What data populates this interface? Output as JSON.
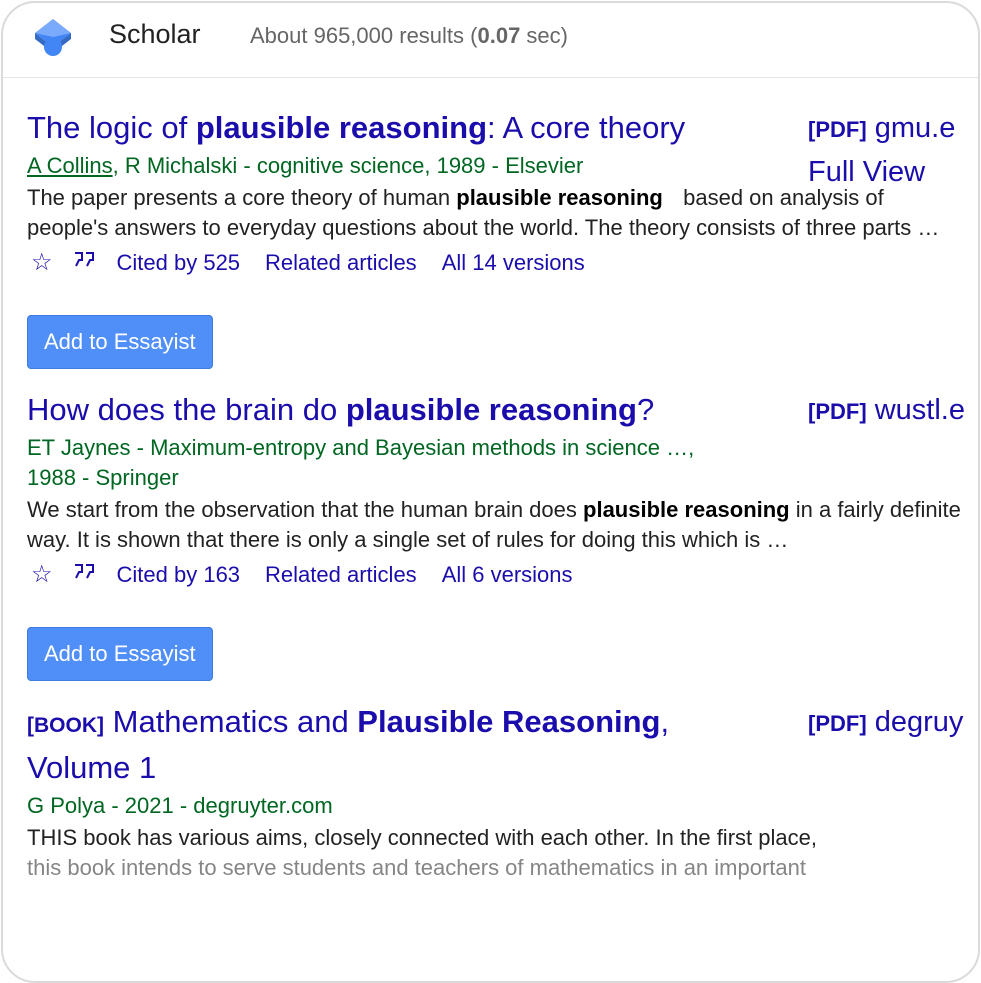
{
  "header": {
    "brand": "Scholar",
    "stats_prefix": "About 965,000 results (",
    "stats_time": "0.07",
    "stats_suffix": " sec)"
  },
  "results": [
    {
      "title_parts": [
        "The logic of ",
        "plausible reasoning",
        ": A core theory"
      ],
      "side_tag": "[PDF]",
      "side_source": "gmu.e",
      "side_link": "Full View",
      "authors_link": "A Collins",
      "meta_rest": ", R Michalski - cognitive science, 1989 - Elsevier",
      "snippet_parts": [
        "The paper presents a core theory of human ",
        "plausible reasoning",
        " based on analysis of people's answers to everyday questions about the world. The theory consists of three parts …"
      ],
      "cited": "Cited by 525",
      "related": "Related articles",
      "versions": "All 14 versions",
      "button": "Add to Essayist"
    },
    {
      "title_parts": [
        "How does the brain do ",
        "plausible reasoning",
        "?"
      ],
      "side_tag": "[PDF]",
      "side_source": "wustl.e",
      "meta": "ET Jaynes - Maximum-entropy and Bayesian methods in science …, 1988 - Springer",
      "snippet_parts": [
        "We start from the observation that the human brain does ",
        "plausible reasoning",
        " in a fairly definite way. It is shown that there is only a single set of rules for doing this which is …"
      ],
      "cited": "Cited by 163",
      "related": "Related articles",
      "versions": "All 6 versions",
      "button": "Add to Essayist"
    },
    {
      "book_tag": "[BOOK]",
      "title_parts": [
        "Mathematics and ",
        "Plausible Reasoning",
        ", Volume 1"
      ],
      "side_tag": "[PDF]",
      "side_source": "degruy",
      "meta": "G Polya - 2021 - degruyter.com",
      "snippet_line1": "THIS book has various aims, closely connected with each other. In the first place,",
      "snippet_line2": "this book intends to serve students and teachers of mathematics in an important"
    }
  ],
  "icons": {
    "star": "☆",
    "quote": "99",
    "logo_color": "#4285f4"
  }
}
